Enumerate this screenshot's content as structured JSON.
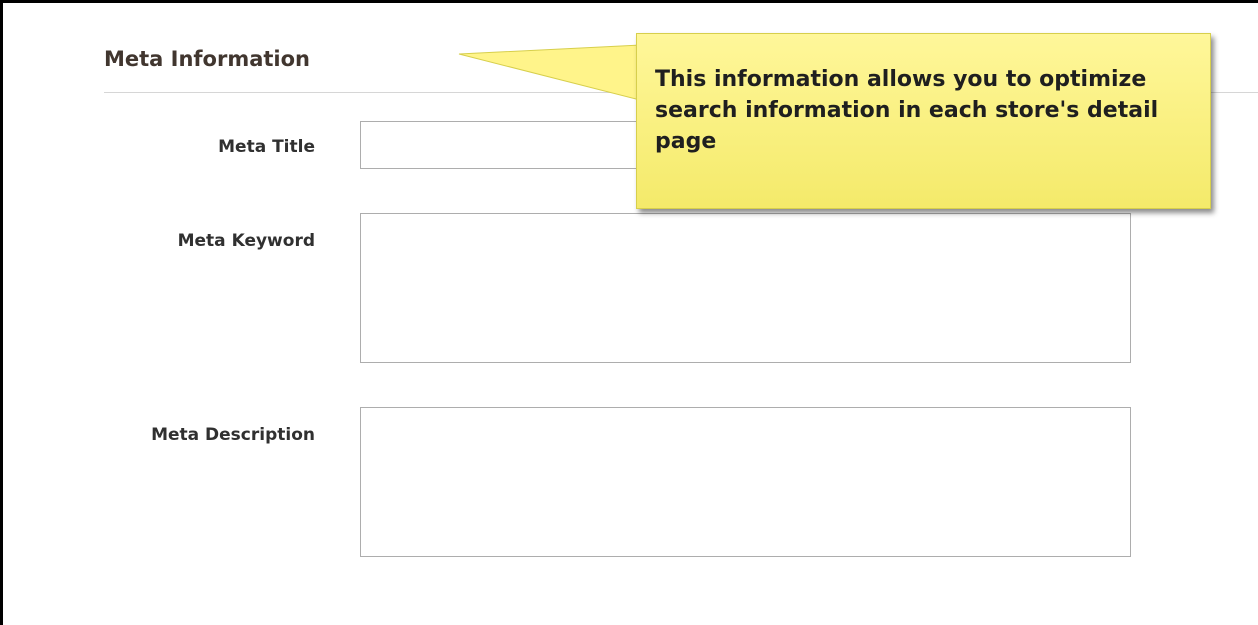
{
  "section": {
    "title": "Meta Information"
  },
  "fields": {
    "meta_title": {
      "label": "Meta Title",
      "value": ""
    },
    "meta_keyword": {
      "label": "Meta Keyword",
      "value": ""
    },
    "meta_description": {
      "label": "Meta Description",
      "value": ""
    }
  },
  "callout": {
    "text": "This information allows you to optimize search information in each store's detail page",
    "color": "#fff79a"
  },
  "colors": {
    "frame_border": "#000000",
    "rule": "#d6d6d6",
    "input_border": "#adadad"
  }
}
